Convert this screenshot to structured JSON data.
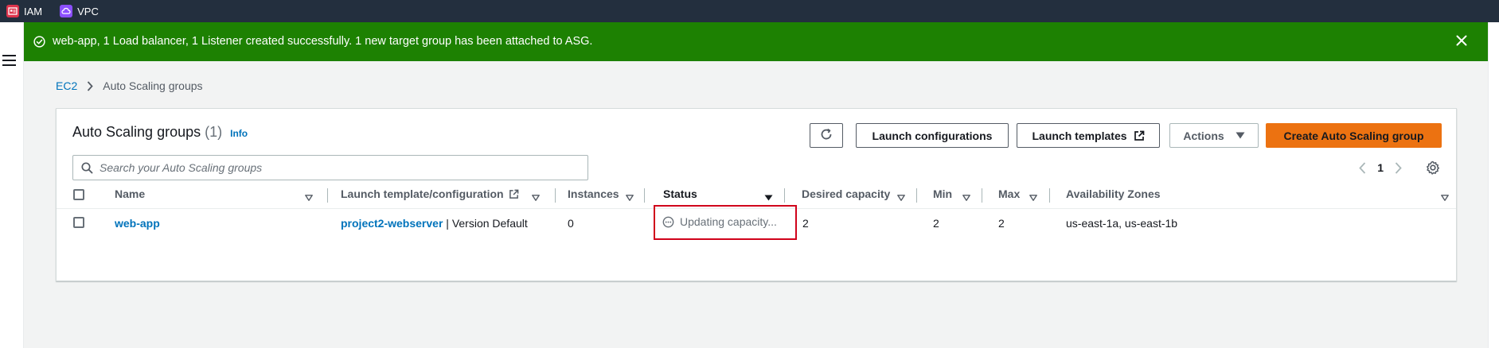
{
  "topbar": {
    "services": [
      {
        "label": "IAM",
        "icon": "iam-icon",
        "color": "#dd344c"
      },
      {
        "label": "VPC",
        "icon": "vpc-icon",
        "color": "#8c4fff"
      }
    ]
  },
  "flash": {
    "message": "web-app, 1 Load balancer, 1 Listener created successfully. 1 new target group has been attached to ASG.",
    "type": "success",
    "color": "#1d8102"
  },
  "breadcrumb": {
    "root": "EC2",
    "current": "Auto Scaling groups"
  },
  "panel": {
    "title": "Auto Scaling groups",
    "count": "(1)",
    "info": "Info",
    "buttons": {
      "refresh": "refresh-icon",
      "launch_configurations": "Launch configurations",
      "launch_templates": "Launch templates",
      "actions": "Actions",
      "create": "Create Auto Scaling group"
    },
    "search": {
      "placeholder": "Search your Auto Scaling groups",
      "value": ""
    },
    "pagination": {
      "page": "1"
    }
  },
  "table": {
    "columns": [
      "Name",
      "Launch template/configuration",
      "Instances",
      "Status",
      "Desired capacity",
      "Min",
      "Max",
      "Availability Zones"
    ],
    "rows": [
      {
        "name": "web-app",
        "template": "project2-webserver",
        "template_suffix": "| Version Default",
        "instances": "0",
        "status": "Updating capacity...",
        "desired": "2",
        "min": "2",
        "max": "2",
        "zones": "us-east-1a, us-east-1b"
      }
    ]
  },
  "colors": {
    "accent": "#ec7211",
    "link": "#0073bb",
    "highlight": "#d0021b"
  }
}
